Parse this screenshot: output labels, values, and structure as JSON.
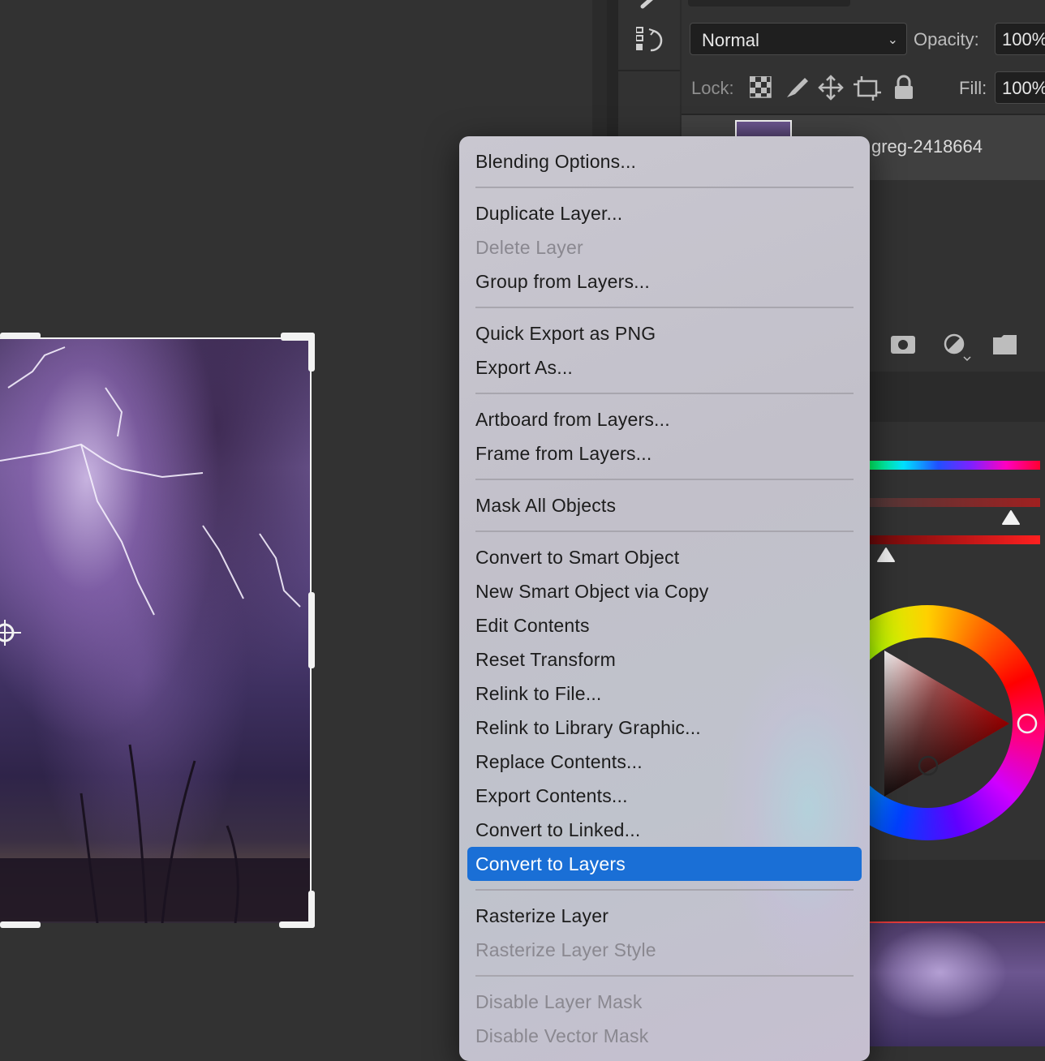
{
  "layers_panel": {
    "blend_mode": "Normal",
    "opacity_label": "Opacity:",
    "opacity_value": "100%",
    "lock_label": "Lock:",
    "fill_label": "Fill:",
    "fill_value": "100%",
    "layer_name": "greg-2418664"
  },
  "context_menu": {
    "items": [
      {
        "label": "Blending Options...",
        "enabled": true
      },
      {
        "label": "Duplicate Layer...",
        "enabled": true
      },
      {
        "label": "Delete Layer",
        "enabled": false
      },
      {
        "label": "Group from Layers...",
        "enabled": true
      },
      {
        "label": "Quick Export as PNG",
        "enabled": true
      },
      {
        "label": "Export As...",
        "enabled": true
      },
      {
        "label": "Artboard from Layers...",
        "enabled": true
      },
      {
        "label": "Frame from Layers...",
        "enabled": true
      },
      {
        "label": "Mask All Objects",
        "enabled": true
      },
      {
        "label": "Convert to Smart Object",
        "enabled": true
      },
      {
        "label": "New Smart Object via Copy",
        "enabled": true
      },
      {
        "label": "Edit Contents",
        "enabled": true
      },
      {
        "label": "Reset Transform",
        "enabled": true
      },
      {
        "label": "Relink to File...",
        "enabled": true
      },
      {
        "label": "Relink to Library Graphic...",
        "enabled": true
      },
      {
        "label": "Replace Contents...",
        "enabled": true
      },
      {
        "label": "Export Contents...",
        "enabled": true
      },
      {
        "label": "Convert to Linked...",
        "enabled": true
      },
      {
        "label": "Convert to Layers",
        "enabled": true,
        "selected": true
      },
      {
        "label": "Rasterize Layer",
        "enabled": true
      },
      {
        "label": "Rasterize Layer Style",
        "enabled": false
      },
      {
        "label": "Disable Layer Mask",
        "enabled": false
      },
      {
        "label": "Disable Vector Mask",
        "enabled": false
      }
    ]
  },
  "colors": {
    "selection_highlight": "#1a6fd6",
    "disabled_text": "#8a8890"
  }
}
